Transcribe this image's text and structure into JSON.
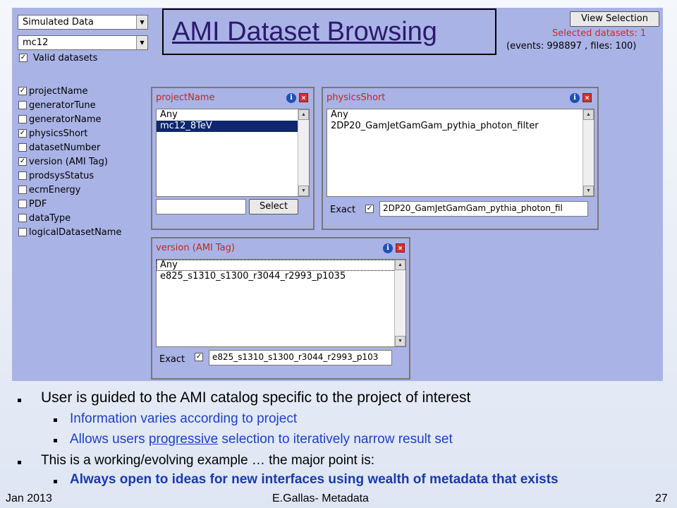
{
  "title": "AMI Dataset Browsing",
  "filters": {
    "data_source": "Simulated Data",
    "project": "mc12",
    "valid_datasets_label": "Valid datasets"
  },
  "view_selection_label": "View Selection",
  "selected_datasets": "Selected datasets: 1",
  "events_files": "(events: 998897 , files: 100)",
  "fields": [
    {
      "label": "projectName",
      "checked": true
    },
    {
      "label": "generatorTune",
      "checked": false
    },
    {
      "label": "generatorName",
      "checked": false
    },
    {
      "label": "physicsShort",
      "checked": true
    },
    {
      "label": "datasetNumber",
      "checked": false
    },
    {
      "label": "version (AMI Tag)",
      "checked": true
    },
    {
      "label": "prodsysStatus",
      "checked": false
    },
    {
      "label": "ecmEnergy",
      "checked": false
    },
    {
      "label": "PDF",
      "checked": false
    },
    {
      "label": "dataType",
      "checked": false
    },
    {
      "label": "logicalDatasetName",
      "checked": false
    }
  ],
  "project_box": {
    "title": "projectName",
    "items": [
      "Any",
      "mc12_8TeV"
    ],
    "search_value": "",
    "select_label": "Select"
  },
  "physics_box": {
    "title": "physicsShort",
    "items": [
      "Any",
      "2DP20_GamJetGamGam_pythia_photon_filter"
    ],
    "exact_label": "Exact",
    "exact_value": "2DP20_GamJetGamGam_pythia_photon_fil"
  },
  "version_box": {
    "title": "version (AMI Tag)",
    "items": [
      "Any",
      "e825_s1310_s1300_r3044_r2993_p1035"
    ],
    "exact_label": "Exact",
    "exact_value": "e825_s1310_s1300_r3044_r2993_p103"
  },
  "bullets": {
    "b1": "User is guided to the AMI catalog specific to the project of interest",
    "b1a": "Information varies according to project",
    "b1b_pre": "Allows users ",
    "b1b_u": "progressive",
    "b1b_post": " selection to iteratively narrow result set",
    "b2": "This is a working/evolving example … the major point is:",
    "b2a": "Always open to ideas for new interfaces using wealth of metadata that exists"
  },
  "footer": {
    "date": "Jan  2013",
    "author": "E.Gallas- Metadata",
    "page": "27"
  }
}
